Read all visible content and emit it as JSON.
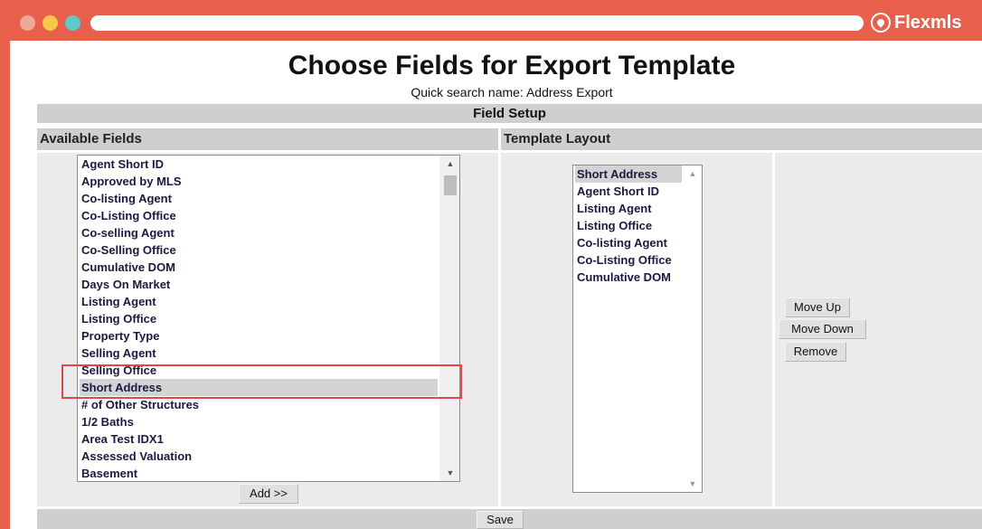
{
  "window": {
    "brand": "Flexmls",
    "brand_icon": "location-pin-icon",
    "colors": {
      "frame": "#e8604c",
      "dot_red": "#f0a89a",
      "dot_yellow": "#f7c948",
      "dot_green": "#5ec9c9",
      "highlight": "#e0474c"
    }
  },
  "page": {
    "title": "Choose Fields for Export Template",
    "subtitle": "Quick search name: Address Export",
    "section_title": "Field Setup",
    "available_header": "Available Fields",
    "template_header": "Template Layout"
  },
  "available_fields": {
    "items": [
      "Agent Short ID",
      "Approved by MLS",
      "Co-listing Agent",
      "Co-Listing Office",
      "Co-selling Agent",
      "Co-Selling Office",
      "Cumulative DOM",
      "Days On Market",
      "Listing Agent",
      "Listing Office",
      "Property Type",
      "Selling Agent",
      "Selling Office",
      "Short Address",
      "# of Other Structures",
      "1/2 Baths",
      "Area Test IDX1",
      "Assessed Valuation",
      "Basement"
    ],
    "selected": "Short Address"
  },
  "template_layout": {
    "items": [
      "Short Address",
      "Agent Short ID",
      "Listing Agent",
      "Listing Office",
      "Co-listing Agent",
      "Co-Listing Office",
      "Cumulative DOM"
    ],
    "selected": "Short Address"
  },
  "buttons": {
    "add": "Add >>",
    "move_up": "Move Up",
    "move_down": "Move Down",
    "remove": "Remove",
    "save": "Save"
  }
}
